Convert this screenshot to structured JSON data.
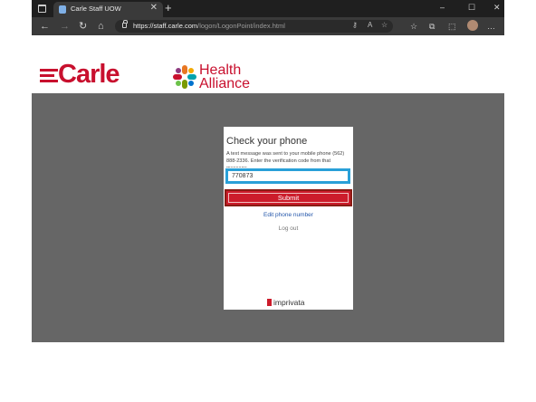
{
  "browser": {
    "tab_title": "Carle Staff UOW",
    "tab_close": "✕",
    "new_tab": "+",
    "window_controls": {
      "minimize": "–",
      "maximize": "☐",
      "close": "✕"
    },
    "url_domain": "https://staff.carle.com",
    "url_path": "/logon/LogonPoint/index.html",
    "nav": {
      "back": "←",
      "forward": "→",
      "refresh": "↻",
      "home": "⌂"
    },
    "url_icons": {
      "key": "⚷",
      "read_aloud": "A",
      "favorite_add": "☆"
    },
    "toolbar": {
      "favorites": "☆",
      "collections": "⧉",
      "extensions": "⬚",
      "more": "…"
    },
    "icons": [
      "window-menu-icon",
      "favicon-icon",
      "lock-icon",
      "key-icon",
      "read-aloud-icon",
      "add-favorite-icon",
      "favorites-icon",
      "collections-icon",
      "extensions-icon",
      "profile-icon",
      "more-icon"
    ]
  },
  "header": {
    "carle_logo": "Carle",
    "health_alliance": [
      "Health",
      "Alliance"
    ]
  },
  "login_card": {
    "title": "Check your phone",
    "message": "A text message was sent to your mobile phone (562) 888-2336. Enter the verification code from that message.",
    "code_value": "770873",
    "submit_label": "Submit",
    "edit_phone_label": "Edit phone number",
    "logout_label": "Log out",
    "footer_brand": "imprivata"
  },
  "colors": {
    "brand_red": "#c8102e",
    "input_highlight": "#29a0d8",
    "button_outline": "#8a1c14",
    "page_gray": "#666666"
  }
}
